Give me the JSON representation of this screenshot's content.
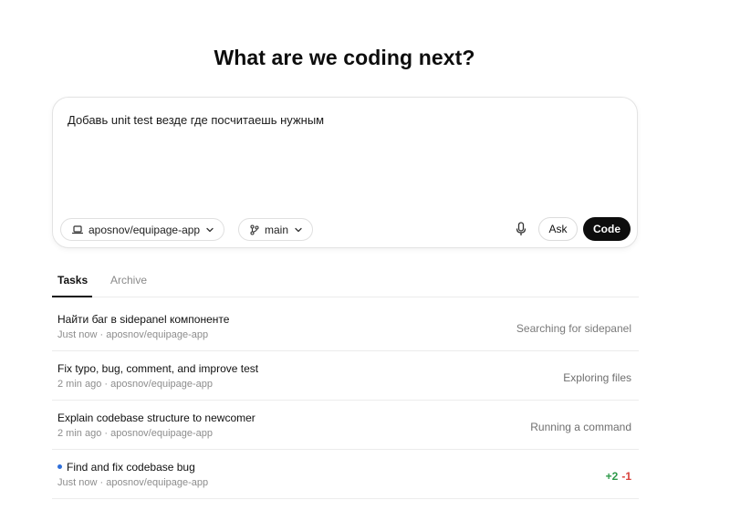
{
  "heading": "What are we coding next?",
  "composer": {
    "prompt": "Добавь unit test везде где посчитаешь нужным",
    "repo_chip": {
      "icon": "laptop-icon",
      "label": "aposnov/equipage-app"
    },
    "branch_chip": {
      "icon": "git-branch-icon",
      "label": "main"
    },
    "mic_icon": "microphone-icon",
    "ask_label": "Ask",
    "code_label": "Code"
  },
  "tabs": [
    {
      "label": "Tasks",
      "active": true
    },
    {
      "label": "Archive",
      "active": false
    }
  ],
  "tasks": [
    {
      "title": "Найти баг в sidepanel компоненте",
      "time": "Just now",
      "repo": "aposnov/equipage-app",
      "status": "Searching for sidepanel"
    },
    {
      "title": "Fix typo, bug, comment, and improve test",
      "time": "2 min ago",
      "repo": "aposnov/equipage-app",
      "status": "Exploring files"
    },
    {
      "title": "Explain codebase structure to newcomer",
      "time": "2 min ago",
      "repo": "aposnov/equipage-app",
      "status": "Running a command"
    },
    {
      "title": "Find and fix codebase bug",
      "time": "Just now",
      "repo": "aposnov/equipage-app",
      "unread": true,
      "additions": "+2",
      "deletions": "-1"
    }
  ],
  "meta_separator": " · ",
  "colors": {
    "accent_dark": "#0d0d0d",
    "additions": "#2e9a4a",
    "deletions": "#d8403a",
    "unread_dot": "#2f6fda"
  }
}
